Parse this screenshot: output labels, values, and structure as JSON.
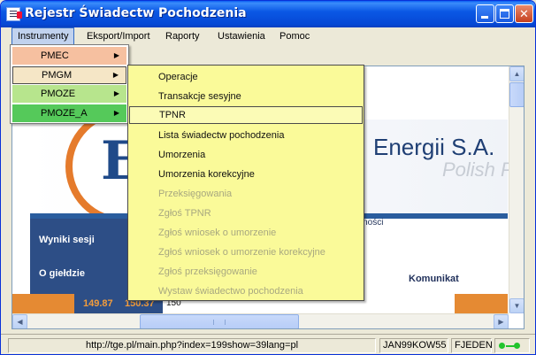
{
  "window": {
    "title": "Rejestr Świadectw Pochodzenia",
    "minimize_label": "",
    "maximize_label": "",
    "close_label": "✕"
  },
  "menubar": {
    "items": [
      "Instrumenty",
      "Eksport/Import",
      "Raporty",
      "Ustawienia",
      "Pomoc"
    ]
  },
  "instrumenty_menu": {
    "items": [
      {
        "label": "PMEC",
        "color": "#f6c0a0"
      },
      {
        "label": "PMGM",
        "color": "#f5e6c6"
      },
      {
        "label": "PMOZE",
        "color": "#b7e58d"
      },
      {
        "label": "PMOZE_A",
        "color": "#55c95a"
      }
    ],
    "submenu_arrow": "▶"
  },
  "pmgm_submenu": {
    "items": [
      {
        "label": "Operacje",
        "enabled": true
      },
      {
        "label": "Transakcje sesyjne",
        "enabled": true
      },
      {
        "label": "TPNR",
        "enabled": true,
        "selected": true
      },
      {
        "label": "Lista świadectw pochodzenia",
        "enabled": true
      },
      {
        "label": "Umorzenia",
        "enabled": true
      },
      {
        "label": "Umorzenia korekcyjne",
        "enabled": true
      },
      {
        "label": "Przeksięgowania",
        "enabled": false
      },
      {
        "label": "Zgłoś TPNR",
        "enabled": false
      },
      {
        "label": "Zgłoś wniosek o umorzenie",
        "enabled": false
      },
      {
        "label": "Zgłoś wniosek o umorzenie korekcyjne",
        "enabled": false
      },
      {
        "label": "Zgłoś przeksięgowanie",
        "enabled": false
      },
      {
        "label": "Wystaw świadectwo pochodzenia",
        "enabled": false
      }
    ]
  },
  "webpage": {
    "logo_letter": "E",
    "company": "Energii S.A.",
    "company_sub": "Polish P",
    "aktualnosci": "tualności",
    "nav": [
      "Wyniki sesji",
      "O giełdzie"
    ],
    "komunikat": "Komunikat",
    "quotes": [
      "149.87",
      "150.37",
      "150"
    ]
  },
  "statusbar": {
    "url": "http://tge.pl/main.php?index=199show=39lang=pl",
    "code": "JAN99KOW55",
    "user": "FJEDEN"
  },
  "colors": {
    "titlebar": "#0a58e5",
    "menu_highlight": "#fafa99",
    "orange": "#e58a33",
    "navy": "#2d4e86"
  }
}
